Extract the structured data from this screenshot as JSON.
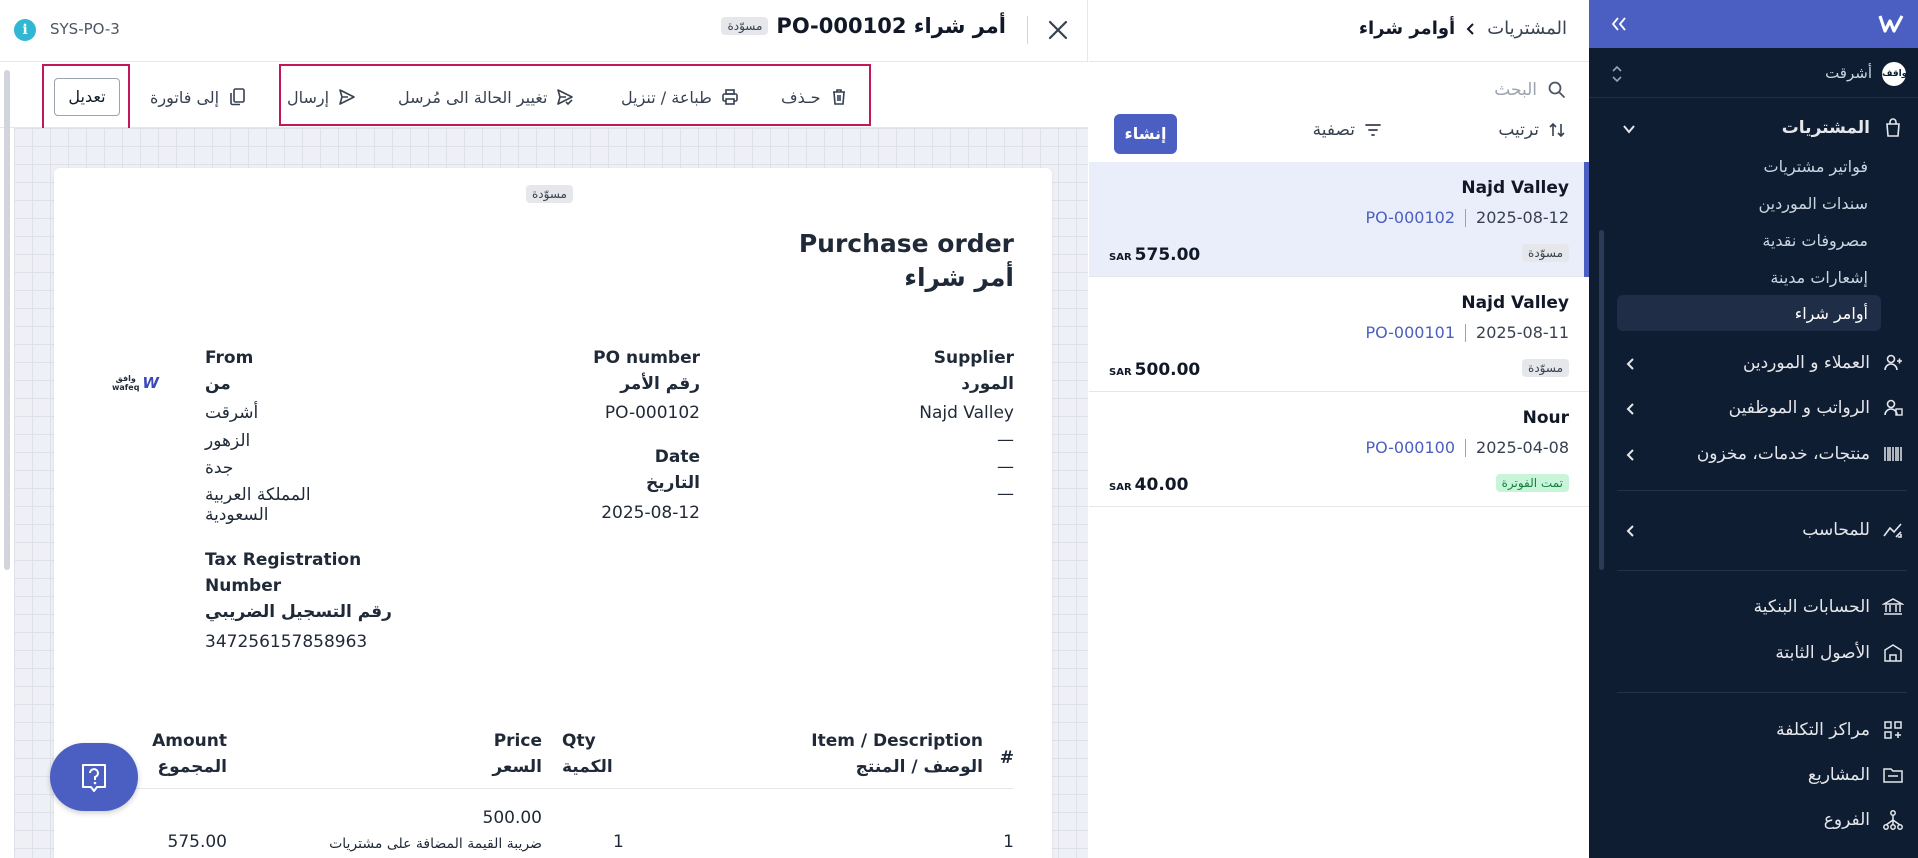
{
  "detail": {
    "sys_id": "SYS-PO-3",
    "title": "أمر شراء PO-000102",
    "status_badge": "مسوّدة",
    "toolbar": {
      "edit": "تعديل",
      "to_invoice": "إلى فاتورة",
      "send": "إرسال",
      "change_status": "تغيير الحالة الى مُرسل",
      "print": "طباعة / تنزيل",
      "delete": "حـذف"
    },
    "document": {
      "badge": "مسوّدة",
      "title_en": "Purchase order",
      "title_ar": "أمر شراء",
      "supplier": {
        "label_en": "Supplier",
        "label_ar": "المورد",
        "name": "Najd Valley",
        "lines": [
          "—",
          "—",
          "—"
        ]
      },
      "po": {
        "label_en": "PO number",
        "label_ar": "رقم الأمر",
        "value": "PO-000102",
        "date_label_en": "Date",
        "date_label_ar": "التاريخ",
        "date": "2025-08-12"
      },
      "from": {
        "label_en": "From",
        "label_ar": "من",
        "name": "أشرقت",
        "district": "الزهور",
        "city": "جدة",
        "country_line1": "المملكة العربية",
        "country_line2": "السعودية",
        "tax_label_en_1": "Tax Registration",
        "tax_label_en_2": "Number",
        "tax_label_ar": "رقم التسجيل الضريبي",
        "tax_number": "347256157858963"
      },
      "logo": {
        "mark": "W",
        "text_ar": "وافق",
        "text_en": "wafeq"
      },
      "table": {
        "col_num": "#",
        "col_item_en": "Item / Description",
        "col_item_ar": "الوصف / المنتج",
        "col_qty_en": "Qty",
        "col_qty_ar": "الكمية",
        "col_price_en": "Price",
        "col_price_ar": "السعر",
        "col_amount_en": "Amount",
        "col_amount_ar": "المجموع",
        "rows": [
          {
            "num": "1",
            "qty": "1",
            "price": "500.00",
            "tax_note": "ضريبة القيمة المضافة على مشتريات",
            "amount": "575.00"
          }
        ]
      }
    }
  },
  "list": {
    "breadcrumb_parent": "المشتريات",
    "breadcrumb_current": "أوامر شراء",
    "search_placeholder": "البحث",
    "sort_label": "ترتيب",
    "filter_label": "تصفية",
    "create_label": "إنشاء",
    "currency": "SAR",
    "items": [
      {
        "name": "Najd Valley",
        "date": "2025-08-12",
        "number": "PO-000102",
        "amount": "575.00",
        "status": "مسوّدة"
      },
      {
        "name": "Najd Valley",
        "date": "2025-08-11",
        "number": "PO-000101",
        "amount": "500.00",
        "status": "مسوّدة"
      },
      {
        "name": "Nour",
        "date": "2025-04-08",
        "number": "PO-000100",
        "amount": "40.00",
        "status": "تمت الفوترة"
      }
    ]
  },
  "sidebar": {
    "org_name": "أشرقت",
    "org_avatar": "واقف",
    "purchases": {
      "label": "المشتريات",
      "subitems": [
        "فواتير مشتريات",
        "سندات الموردين",
        "مصروفات نقدية",
        "إشعارات مدينة",
        "أوامر شراء"
      ]
    },
    "items": {
      "customers_suppliers": "العملاء و الموردين",
      "payroll": "الرواتب و الموظفين",
      "products": "منتجات، خدمات، مخزون",
      "accountants": "للمحاسب",
      "bank_accounts": "الحسابات البنكية",
      "fixed_assets": "الأصول الثابتة",
      "cost_centers": "مراكز التكلفة",
      "projects": "المشاريع",
      "branches": "الفروع"
    }
  },
  "colors": {
    "accent": "#4b5fc2",
    "sidebar_bg": "#0f1d33",
    "highlight_box": "#c2185b",
    "paid_badge": "#c8f5d9"
  }
}
